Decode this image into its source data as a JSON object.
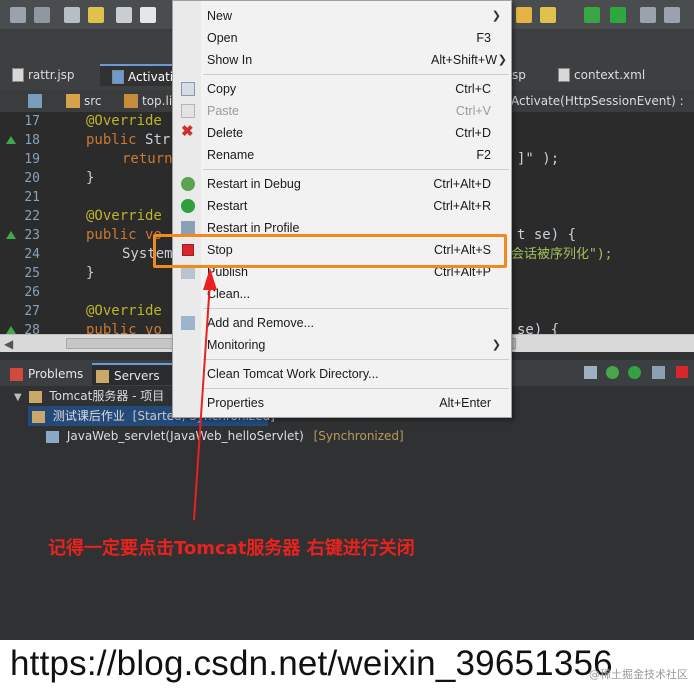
{
  "editor_tabs": [
    {
      "label": "rattr.jsp"
    },
    {
      "label": "Activatio"
    },
    {
      "label": "sp"
    },
    {
      "label": "context.xml"
    }
  ],
  "breadcrumb": {
    "src": "src",
    "top": "top.li",
    "method": "Activate(HttpSessionEvent) : voi"
  },
  "gutter": [
    "17",
    "18",
    "19",
    "20",
    "21",
    "22",
    "23",
    "24",
    "25",
    "26",
    "27",
    "28"
  ],
  "code": {
    "l17": "@Override",
    "l18a": "public ",
    "l18b": "Str",
    "l19a": "return",
    "l19b": "]\" );",
    "l20": "}",
    "l22": "@Override",
    "l23a": "public ",
    "l23b": "vo",
    "l23c": "t se) {",
    "l24a": "System",
    "l24b": "会话被序列化\");",
    "l25": "}",
    "l27": "@Override",
    "l28a": "public ",
    "l28b": "vo",
    "l28c": "se) {"
  },
  "panel_tabs": {
    "problems": "Problems",
    "servers": "Servers"
  },
  "tree": {
    "server": "Tomcat服务器 - 项目",
    "selected_name": "测试课后作业",
    "selected_status": "[Started, Synchronized]",
    "child_name": "JavaWeb_servlet(JavaWeb_helloServlet)",
    "child_status": "[Synchronized]"
  },
  "menu": {
    "new": "New",
    "open": "Open",
    "open_sc": "F3",
    "show_in": "Show In",
    "show_in_sc": "Alt+Shift+W",
    "copy": "Copy",
    "copy_sc": "Ctrl+C",
    "paste": "Paste",
    "paste_sc": "Ctrl+V",
    "delete": "Delete",
    "delete_sc": "Ctrl+D",
    "rename": "Rename",
    "rename_sc": "F2",
    "restart_debug": "Restart in Debug",
    "restart_debug_sc": "Ctrl+Alt+D",
    "restart": "Restart",
    "restart_sc": "Ctrl+Alt+R",
    "restart_profile": "Restart in Profile",
    "stop": "Stop",
    "stop_sc": "Ctrl+Alt+S",
    "publish": "Publish",
    "publish_sc": "Ctrl+Alt+P",
    "clean": "Clean...",
    "add_remove": "Add and Remove...",
    "monitoring": "Monitoring",
    "clean_tomcat": "Clean Tomcat Work Directory...",
    "properties": "Properties",
    "properties_sc": "Alt+Enter"
  },
  "annotation": "记得一定要点击Tomcat服务器 右键进行关闭",
  "url": "https://blog.csdn.net/weixin_39651356",
  "watermark": "@稀土掘金技术社区",
  "colors": {
    "accent": "#f2891f",
    "annotation": "#e8221f",
    "stop_icon": "#d9252b"
  }
}
